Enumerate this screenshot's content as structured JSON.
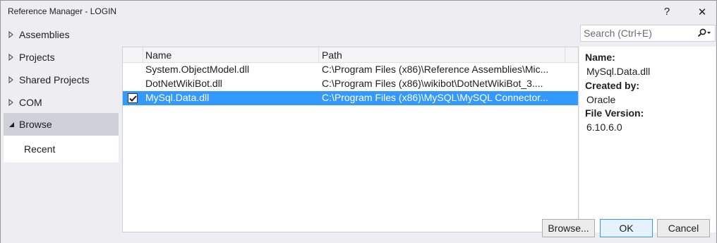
{
  "window": {
    "title": "Reference Manager - LOGIN",
    "help_glyph": "?",
    "close_glyph": "✕"
  },
  "sidebar": {
    "items": [
      {
        "label": "Assemblies",
        "expanded": false
      },
      {
        "label": "Projects",
        "expanded": false
      },
      {
        "label": "Shared Projects",
        "expanded": false
      },
      {
        "label": "COM",
        "expanded": false
      },
      {
        "label": "Browse",
        "expanded": true
      }
    ],
    "sub_items": [
      {
        "label": "Recent"
      }
    ]
  },
  "search": {
    "placeholder": "Search (Ctrl+E)",
    "value": ""
  },
  "list": {
    "columns": [
      "Name",
      "Path"
    ],
    "rows": [
      {
        "name": "System.ObjectModel.dll",
        "path": "C:\\Program Files (x86)\\Reference Assemblies\\Mic...",
        "checked": false,
        "selected": false
      },
      {
        "name": "DotNetWikiBot.dll",
        "path": "C:\\Program Files (x86)\\wikibot\\DotNetWikiBot_3....",
        "checked": false,
        "selected": false
      },
      {
        "name": "MySql.Data.dll",
        "path": "C:\\Program Files (x86)\\MySQL\\MySQL Connector...",
        "checked": true,
        "selected": true
      }
    ]
  },
  "details": {
    "name_label": "Name:",
    "name_value": "MySql.Data.dll",
    "created_by_label": "Created by:",
    "created_by_value": "Oracle",
    "file_version_label": "File Version:",
    "file_version_value": "6.10.6.0"
  },
  "buttons": {
    "browse": "Browse...",
    "ok": "OK",
    "cancel": "Cancel"
  },
  "colors": {
    "selection": "#3399ff",
    "chrome": "#eeeef2",
    "sidebar_active": "#cfd0da"
  }
}
